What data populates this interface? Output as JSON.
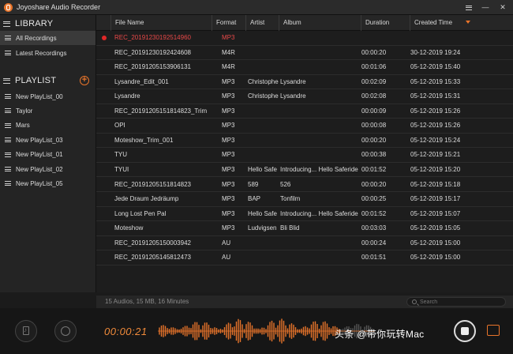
{
  "window": {
    "title": "Joyoshare Audio Recorder",
    "menu_icon": "hamburger-icon",
    "minimize_icon": "minimize-icon",
    "close_icon": "close-icon"
  },
  "sidebar": {
    "library_title": "LIBRARY",
    "library_items": [
      {
        "label": "All Recordings",
        "active": true
      },
      {
        "label": "Latest Recordings",
        "active": false
      }
    ],
    "playlist_title": "PLAYLIST",
    "playlist_items": [
      {
        "label": "New PlayList_00"
      },
      {
        "label": "Taylor"
      },
      {
        "label": "Mars"
      },
      {
        "label": "New PlayList_03"
      },
      {
        "label": "New PlayList_01"
      },
      {
        "label": "New PlayList_02"
      },
      {
        "label": "New PlayList_05"
      }
    ]
  },
  "table": {
    "columns": [
      "File Name",
      "Format",
      "Artist",
      "Album",
      "Duration",
      "Created Time"
    ],
    "rows": [
      {
        "name": "REC_20191230192514960",
        "format": "MP3",
        "artist": "",
        "album": "",
        "duration": "",
        "created": "",
        "active": true
      },
      {
        "name": "REC_20191230192424608",
        "format": "M4R",
        "artist": "",
        "album": "",
        "duration": "00:00:20",
        "created": "30-12-2019 19:24"
      },
      {
        "name": "REC_20191205153906131",
        "format": "M4R",
        "artist": "",
        "album": "",
        "duration": "00:01:06",
        "created": "05-12-2019 15:40"
      },
      {
        "name": "Lysandre_Edit_001",
        "format": "MP3",
        "artist": "Christophe",
        "album": "Lysandre",
        "duration": "00:02:09",
        "created": "05-12-2019 15:33"
      },
      {
        "name": "Lysandre",
        "format": "MP3",
        "artist": "Christophe",
        "album": "Lysandre",
        "duration": "00:02:08",
        "created": "05-12-2019 15:31"
      },
      {
        "name": "REC_20191205151814823_Trim",
        "format": "MP3",
        "artist": "",
        "album": "",
        "duration": "00:00:09",
        "created": "05-12-2019 15:26"
      },
      {
        "name": "OPI",
        "format": "MP3",
        "artist": "",
        "album": "",
        "duration": "00:00:08",
        "created": "05-12-2019 15:26"
      },
      {
        "name": "Moteshow_Trim_001",
        "format": "MP3",
        "artist": "",
        "album": "",
        "duration": "00:00:20",
        "created": "05-12-2019 15:24"
      },
      {
        "name": "TYU",
        "format": "MP3",
        "artist": "",
        "album": "",
        "duration": "00:00:38",
        "created": "05-12-2019 15:21"
      },
      {
        "name": "TYUI",
        "format": "MP3",
        "artist": "Hello Safe",
        "album": "Introducing... Hello Saferide",
        "duration": "00:01:52",
        "created": "05-12-2019 15:20"
      },
      {
        "name": "REC_20191205151814823",
        "format": "MP3",
        "artist": "589",
        "album": "526",
        "duration": "00:00:20",
        "created": "05-12-2019 15:18"
      },
      {
        "name": "Jede Draum Jedräump",
        "format": "MP3",
        "artist": "BAP",
        "album": "Tonfilm",
        "duration": "00:00:25",
        "created": "05-12-2019 15:17"
      },
      {
        "name": "Long Lost Pen Pal",
        "format": "MP3",
        "artist": "Hello Safe",
        "album": "Introducing... Hello Saferide",
        "duration": "00:01:52",
        "created": "05-12-2019 15:07"
      },
      {
        "name": "Moteshow",
        "format": "MP3",
        "artist": "Ludvigsen",
        "album": "Bli Blid",
        "duration": "00:03:03",
        "created": "05-12-2019 15:05"
      },
      {
        "name": "REC_20191205150003942",
        "format": "AU",
        "artist": "",
        "album": "",
        "duration": "00:00:24",
        "created": "05-12-2019 15:00"
      },
      {
        "name": "REC_20191205145812473",
        "format": "AU",
        "artist": "",
        "album": "",
        "duration": "00:01:51",
        "created": "05-12-2019 15:00"
      }
    ]
  },
  "status": {
    "summary": "15 Audios, 15 MB, 16 Minutes",
    "search_placeholder": "Search"
  },
  "player": {
    "timer": "00:00:21",
    "watermark": "头条 @带你玩转Mac"
  },
  "colors": {
    "accent": "#e8742a",
    "active_row": "#e84848",
    "record_dot": "#e02828"
  }
}
